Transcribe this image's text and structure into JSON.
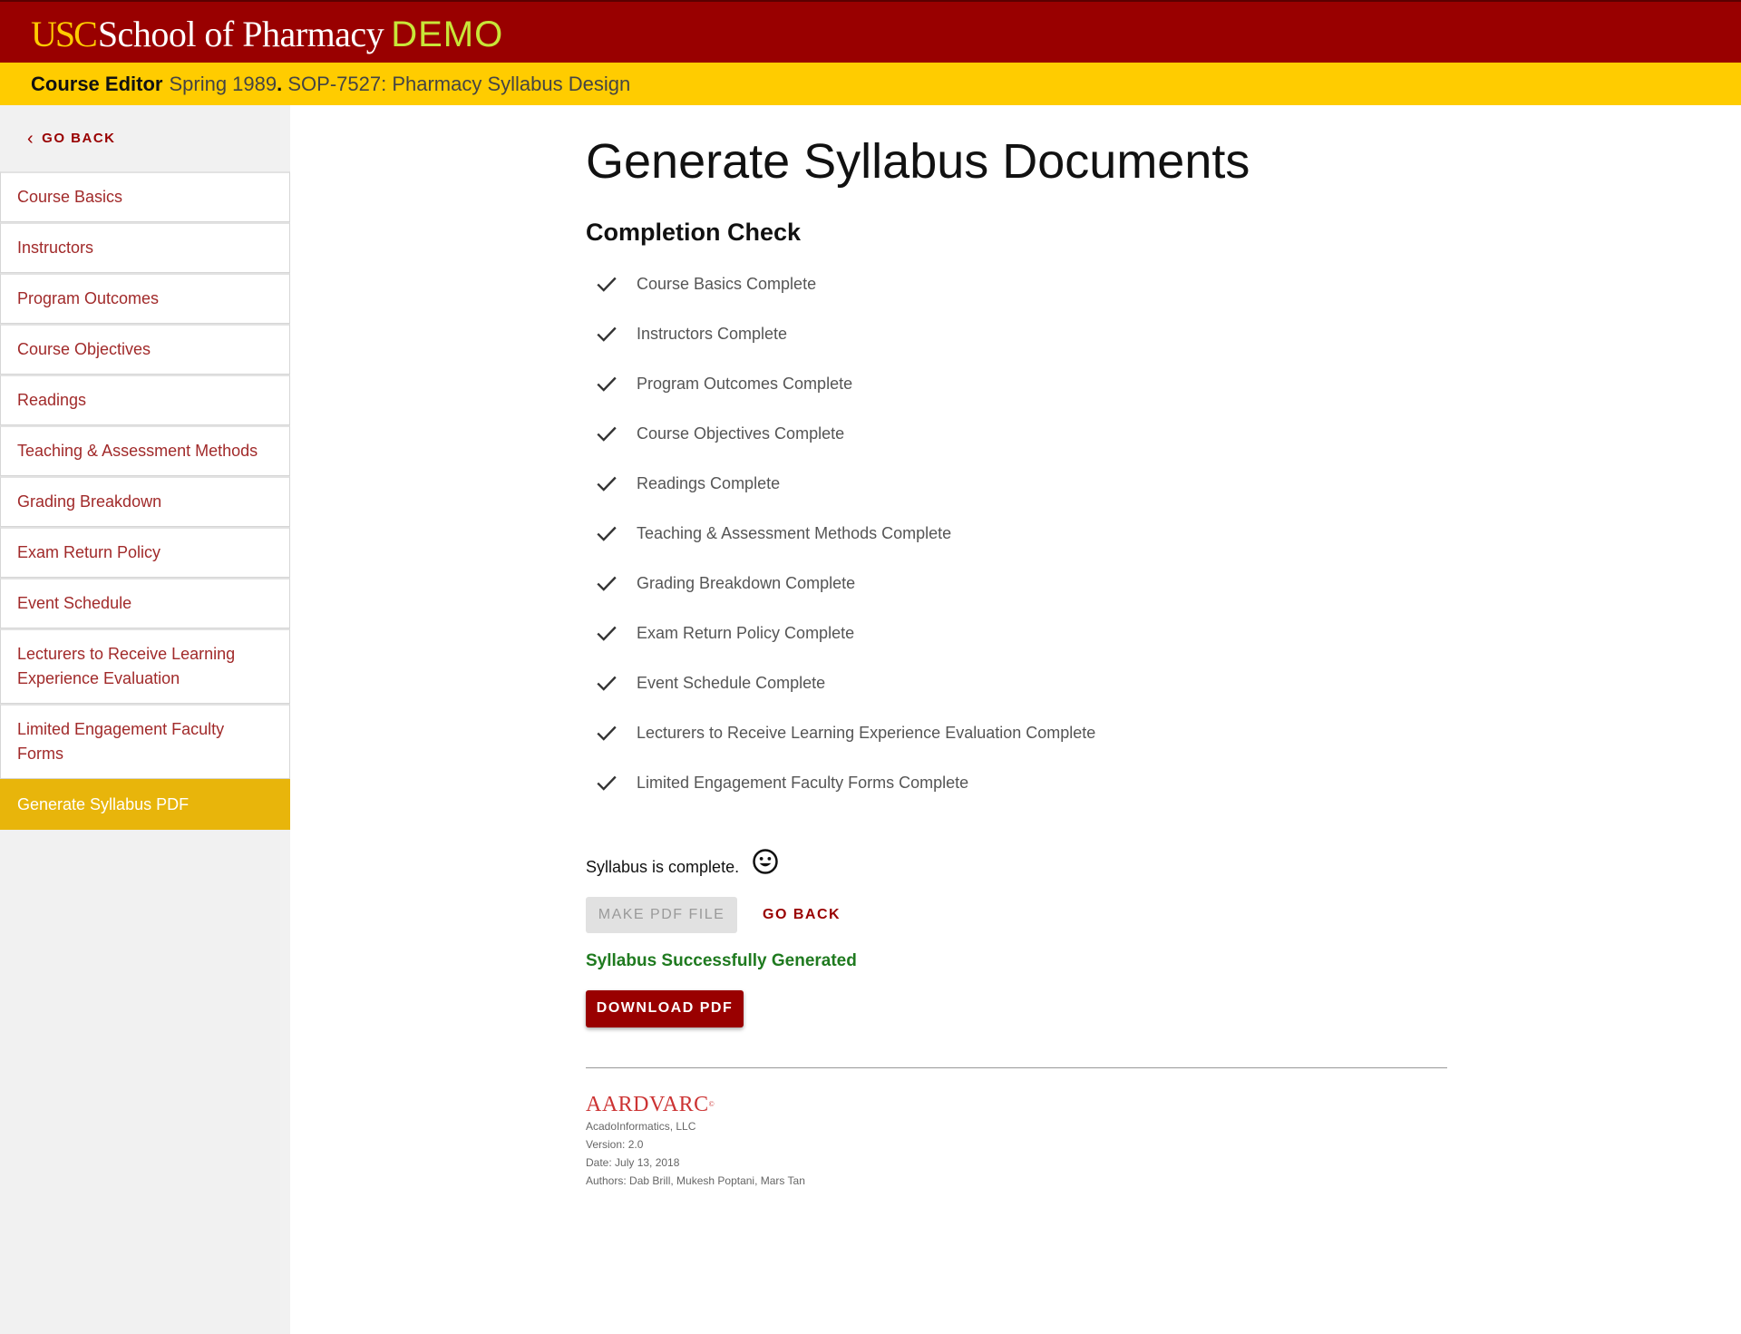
{
  "header": {
    "logo_usc": "USC",
    "logo_school": "School of Pharmacy",
    "logo_demo": "DEMO",
    "editor_label": "Course Editor",
    "term": "Spring 1989",
    "separator": ".",
    "course": "SOP-7527: Pharmacy Syllabus Design"
  },
  "sidebar": {
    "go_back": "GO BACK",
    "items": [
      {
        "label": "Course Basics"
      },
      {
        "label": "Instructors"
      },
      {
        "label": "Program Outcomes"
      },
      {
        "label": "Course Objectives"
      },
      {
        "label": "Readings"
      },
      {
        "label": "Teaching & Assessment Methods"
      },
      {
        "label": "Grading Breakdown"
      },
      {
        "label": "Exam Return Policy"
      },
      {
        "label": "Event Schedule"
      },
      {
        "label": "Lecturers to Receive Learning Experience Evaluation"
      },
      {
        "label": "Limited Engagement Faculty Forms"
      },
      {
        "label": "Generate Syllabus PDF",
        "active": true
      }
    ]
  },
  "main": {
    "title": "Generate Syllabus Documents",
    "completion_title": "Completion Check",
    "checks": [
      "Course Basics Complete",
      "Instructors Complete",
      "Program Outcomes Complete",
      "Course Objectives Complete",
      "Readings Complete",
      "Teaching & Assessment Methods Complete",
      "Grading Breakdown Complete",
      "Exam Return Policy Complete",
      "Event Schedule Complete",
      "Lecturers to Receive Learning Experience Evaluation Complete",
      "Limited Engagement Faculty Forms Complete"
    ],
    "status_text": "Syllabus is complete.",
    "make_pdf_label": "MAKE PDF FILE",
    "go_back_label": "GO BACK",
    "success_text": "Syllabus Successfully Generated",
    "download_label": "DOWNLOAD PDF"
  },
  "footer": {
    "brand": "AARDVARC",
    "brand_mark": "©",
    "company": "AcadoInformatics, LLC",
    "version": "Version: 2.0",
    "date": "Date: July 13, 2018",
    "authors": "Authors: Dab Brill, Mukesh Poptani, Mars Tan"
  },
  "colors": {
    "brand_red": "#990000",
    "brand_gold": "#FFCC00",
    "active_nav": "#E8B50B",
    "demo_green": "#C8E638",
    "success_green": "#1f7a1f"
  }
}
